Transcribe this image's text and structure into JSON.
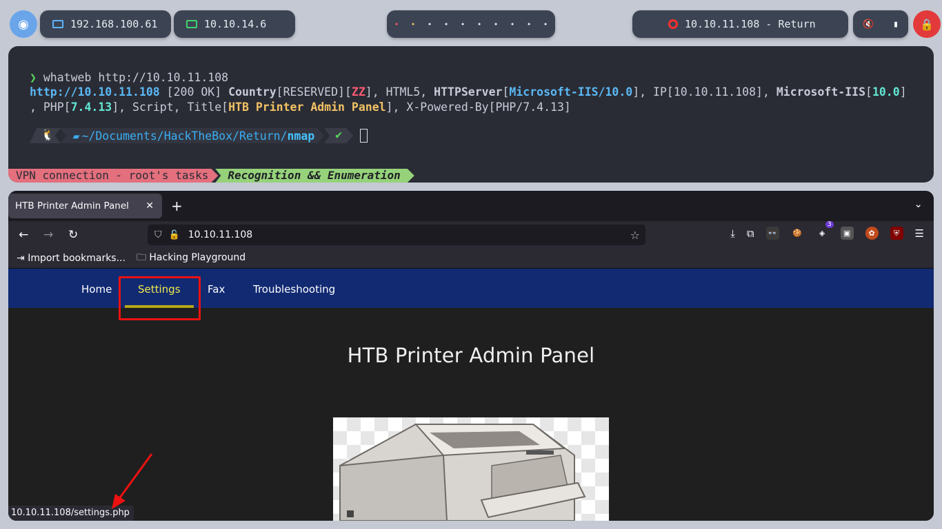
{
  "panel": {
    "local_ip": "192.168.100.61",
    "vpn_ip": "10.10.14.6",
    "target": "10.10.11.108 - Return",
    "workspaces": [
      "•",
      "•",
      "•",
      "•",
      "•",
      "•",
      "•",
      "•",
      "•",
      "•"
    ],
    "accent_colors": {
      "logo": "#6aa5ea",
      "lock": "#e23a3a",
      "ws1": "#ff5a5a",
      "ws2": "#f2c265"
    }
  },
  "terminal": {
    "command_prompt": "❯",
    "command": " whatweb http://10.10.11.108",
    "out": {
      "url": "http://10.10.11.108",
      "status": " [200 OK] ",
      "country_k": "Country",
      "country_v": "[RESERVED][",
      "zz": "ZZ",
      "html5": "], HTML5, ",
      "httpserver_k": "HTTPServer",
      "httpserver_v": "Microsoft-IIS/10.0",
      "ip_k": "], IP",
      "ip_v": "[10.10.11.108], ",
      "iis_k": "Microsoft-IIS",
      "iis_v": "10.0",
      "line2_a": ", PHP",
      "php_v": "7.4.13",
      "line2_b": "], Script, Title",
      "title_v": "HTB Printer Admin Panel",
      "line2_c": "], X-Powered-By",
      "powered_v": "[PHP/7.4.13]"
    },
    "prompt": {
      "os_icon": "🐧",
      "path_prefix": "~/Documents/HackTheBox/Return/",
      "path_dir": "nmap",
      "check": "✔"
    },
    "statusbar": {
      "left": "VPN connection - root's tasks",
      "right": "Recognition && Enumeration"
    }
  },
  "browser": {
    "tab_title": "HTB Printer Admin Panel",
    "url": "10.10.11.108",
    "bookmarks": [
      "Import bookmarks...",
      "Hacking Playground"
    ],
    "ext_badge": "3",
    "status_url": "10.10.11.108/settings.php"
  },
  "site": {
    "nav": [
      "Home",
      "Settings",
      "Fax",
      "Troubleshooting"
    ],
    "active": "Settings",
    "heading": "HTB Printer Admin Panel"
  }
}
